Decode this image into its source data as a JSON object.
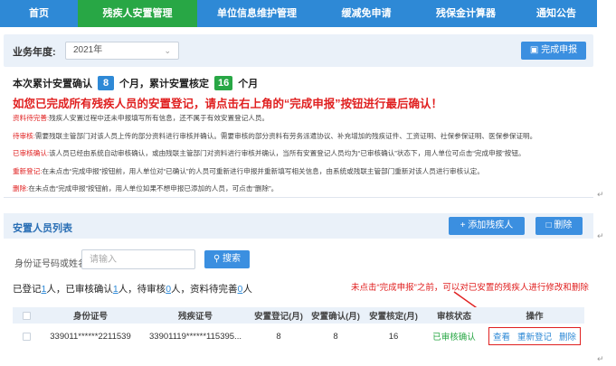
{
  "nav": {
    "items": [
      {
        "label": "首页",
        "active": false
      },
      {
        "label": "残疾人安置管理",
        "active": true
      },
      {
        "label": "单位信息维护管理",
        "active": false
      },
      {
        "label": "缓减免申请",
        "active": false
      },
      {
        "label": "残保金计算器",
        "active": false
      },
      {
        "label": "通知公告",
        "active": false
      }
    ]
  },
  "year": {
    "label": "业务年度:",
    "value": "2021年"
  },
  "finish_button": "完成申报",
  "summary": {
    "part1": "本次累计安置确认",
    "confirm_count": "8",
    "part2": "个月，累计安置核定",
    "verify_count": "16",
    "part3": "个月"
  },
  "warning": "如您已完成所有残疾人员的安置登记，请点击右上角的“完成申报”按钮进行最后确认！",
  "status_lines": [
    {
      "tag": "资料待完善:",
      "text": "残疾人安置过程中还未申报填写所有信息，还不属于有效安置登记人员。"
    },
    {
      "tag": "待审核:",
      "text": "需要残联主管部门对该人员上传的部分资料进行审核并确认。需要审核的部分资料有劳务派遣协议、补充增加的残疾证件、工资证明、社保参保证明、医保参保证明。"
    },
    {
      "tag": "已审核确认:",
      "text": "该人员已经由系统自动审核确认，或由残联主管部门对资料进行审核并确认，当所有安置登记人员均为“已审核确认”状态下，用人单位可点击“完成申报”按钮。"
    },
    {
      "tag": "重新登记:",
      "text": "在未点击“完成申报”按钮前，用人单位对“已确认”的人员可重新进行申报并重新填写相关信息，由系统或残联主管部门重新对该人员进行审核认定。"
    },
    {
      "tag": "删除:",
      "text": "在未点击“完成申报”按钮前，用人单位如果不想申报已添加的人员，可点击“删除”。"
    }
  ],
  "list": {
    "title": "安置人员列表",
    "add_button": "+ 添加残疾人",
    "delete_button": "删除"
  },
  "search": {
    "label": "身份证号码或姓名",
    "placeholder": "请输入",
    "button": "搜索"
  },
  "counts": {
    "t1": "已登记",
    "registered": "1",
    "t2": "人，已审核确认",
    "confirmed": "1",
    "t3": "人，待审核",
    "pending": "0",
    "t4": "人，资料待完善",
    "incomplete": "0",
    "t5": "人"
  },
  "annotation": "未点击“完成申报”之前，可以对已安置的残疾人进行修改和删除",
  "table": {
    "headers": [
      "身份证号",
      "残疾证号",
      "安置登记(月)",
      "安置确认(月)",
      "安置核定(月)",
      "审核状态",
      "操作"
    ],
    "rows": [
      {
        "id_card": "339011******2211539",
        "disability_card": "33901119******115395...",
        "registered": "8",
        "confirmed": "8",
        "verified": "16",
        "status": "已审核确认",
        "actions": [
          "查看",
          "重新登记",
          "删除"
        ]
      }
    ]
  },
  "colors": {
    "nav_blue": "#2e89d6",
    "active_green": "#28a745",
    "warning_red": "#e02020"
  }
}
